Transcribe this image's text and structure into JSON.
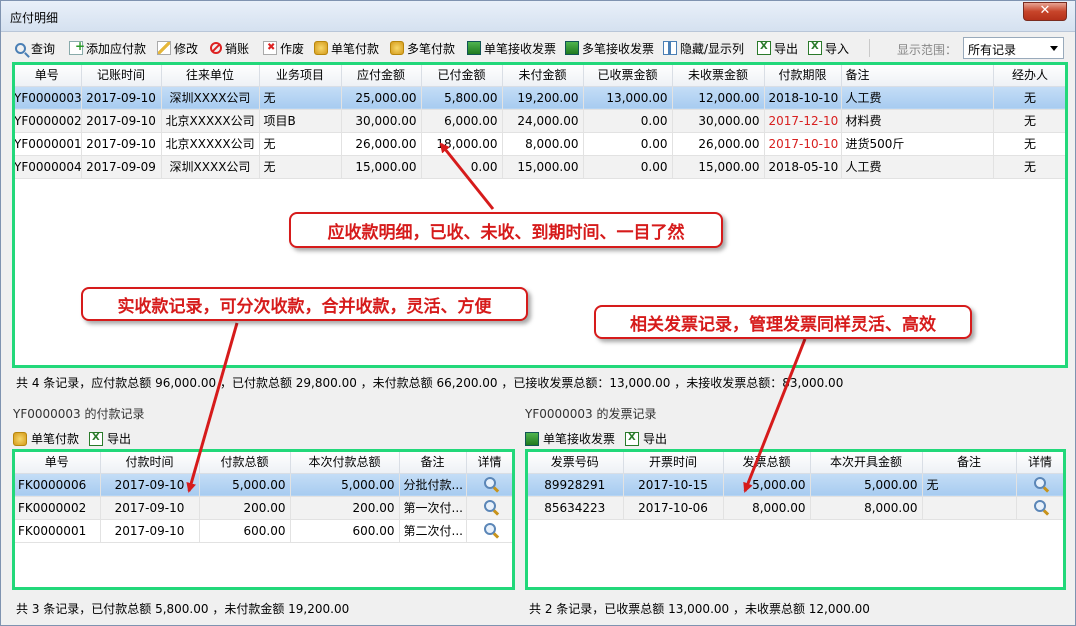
{
  "window": {
    "title": "应付明细",
    "close_label": "✕"
  },
  "toolbar": {
    "buttons": [
      {
        "label": "查询",
        "icon": "search-icon"
      },
      {
        "label": "添加应付款",
        "icon": "add-document-icon"
      },
      {
        "label": "修改",
        "icon": "edit-icon"
      },
      {
        "label": "销账",
        "icon": "ban-icon"
      },
      {
        "label": "作废",
        "icon": "void-icon"
      },
      {
        "label": "单笔付款",
        "icon": "coins-icon"
      },
      {
        "label": "多笔付款",
        "icon": "coins-stack-icon"
      },
      {
        "label": "单笔接收发票",
        "icon": "invoice-icon"
      },
      {
        "label": "多笔接收发票",
        "icon": "invoices-icon"
      },
      {
        "label": "隐藏/显示列",
        "icon": "columns-icon"
      },
      {
        "label": "导出",
        "icon": "excel-export-icon"
      },
      {
        "label": "导入",
        "icon": "excel-import-icon"
      }
    ],
    "range_label": "显示范围：",
    "range_value": "所有记录"
  },
  "main_table": {
    "columns": [
      "单号",
      "记账时间",
      "往来单位",
      "业务项目",
      "应付金额",
      "已付金额",
      "未付金额",
      "已收票金额",
      "未收票金额",
      "付款期限",
      "备注",
      "经办人"
    ],
    "rows": [
      [
        "YF0000003",
        "2017-09-10",
        "深圳XXXX公司",
        "无",
        "25,000.00",
        "5,800.00",
        "19,200.00",
        "13,000.00",
        "12,000.00",
        "2018-10-10",
        "人工费",
        "无"
      ],
      [
        "YF0000002",
        "2017-09-10",
        "北京XXXXX公司",
        "项目B",
        "30,000.00",
        "6,000.00",
        "24,000.00",
        "0.00",
        "30,000.00",
        "2017-12-10",
        "材料费",
        "无"
      ],
      [
        "YF0000001",
        "2017-09-10",
        "北京XXXXX公司",
        "无",
        "26,000.00",
        "18,000.00",
        "8,000.00",
        "0.00",
        "26,000.00",
        "2017-10-10",
        "进货500斤",
        "无"
      ],
      [
        "YF0000004",
        "2017-09-09",
        "深圳XXXX公司",
        "无",
        "15,000.00",
        "0.00",
        "15,000.00",
        "0.00",
        "15,000.00",
        "2018-05-10",
        "人工费",
        "无"
      ]
    ],
    "overdue_color": "#d82020",
    "summary": "共 4 条记录，应付款总额 96,000.00 ，已付款总额 29,800.00 ，未付款总额 66,200.00 ，已接收发票总额：13,000.00 ，未接收发票总额：83,000.00"
  },
  "payments": {
    "title": "YF0000003 的付款记录",
    "toolbar": [
      {
        "label": "单笔付款"
      },
      {
        "label": "导出"
      }
    ],
    "columns": [
      "单号",
      "付款时间",
      "付款总额",
      "本次付款总额",
      "备注",
      "详情"
    ],
    "rows": [
      [
        "FK0000006",
        "2017-09-10",
        "5,000.00",
        "5,000.00",
        "分批付款..."
      ],
      [
        "FK0000002",
        "2017-09-10",
        "200.00",
        "200.00",
        "第一次付..."
      ],
      [
        "FK0000001",
        "2017-09-10",
        "600.00",
        "600.00",
        "第二次付..."
      ]
    ],
    "summary": "共 3 条记录，已付款总额 5,800.00 ，未付款金额 19,200.00"
  },
  "invoices": {
    "title": "YF0000003 的发票记录",
    "toolbar": [
      {
        "label": "单笔接收发票"
      },
      {
        "label": "导出"
      }
    ],
    "columns": [
      "发票号码",
      "开票时间",
      "发票总额",
      "本次开具金额",
      "备注",
      "详情"
    ],
    "rows": [
      [
        "89928291",
        "2017-10-15",
        "5,000.00",
        "5,000.00",
        "无"
      ],
      [
        "85634223",
        "2017-10-06",
        "8,000.00",
        "8,000.00",
        ""
      ]
    ],
    "summary": "共 2 条记录，已收票总额 13,000.00 ，未收票总额 12,000.00"
  },
  "callouts": {
    "main": "应收款明细，已收、未收、到期时间、一目了然",
    "payments": "实收款记录，可分次收款，合并收款，灵活、方便",
    "invoices": "相关发票记录，管理发票同样灵活、高效"
  },
  "accent_colors": {
    "highlight_box": "#22d87a",
    "callout_red": "#d61b1b",
    "selection": "#a7cbf0"
  }
}
